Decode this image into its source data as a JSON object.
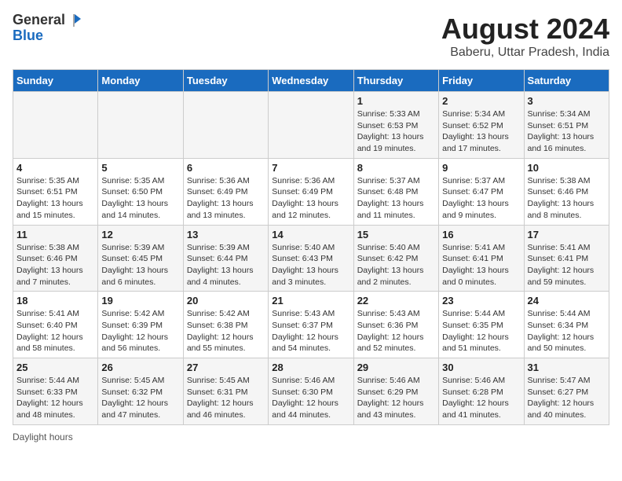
{
  "header": {
    "logo_line1": "General",
    "logo_line2": "Blue",
    "main_title": "August 2024",
    "subtitle": "Baberu, Uttar Pradesh, India"
  },
  "days_of_week": [
    "Sunday",
    "Monday",
    "Tuesday",
    "Wednesday",
    "Thursday",
    "Friday",
    "Saturday"
  ],
  "weeks": [
    [
      {
        "day": "",
        "info": ""
      },
      {
        "day": "",
        "info": ""
      },
      {
        "day": "",
        "info": ""
      },
      {
        "day": "",
        "info": ""
      },
      {
        "day": "1",
        "info": "Sunrise: 5:33 AM\nSunset: 6:53 PM\nDaylight: 13 hours and 19 minutes."
      },
      {
        "day": "2",
        "info": "Sunrise: 5:34 AM\nSunset: 6:52 PM\nDaylight: 13 hours and 17 minutes."
      },
      {
        "day": "3",
        "info": "Sunrise: 5:34 AM\nSunset: 6:51 PM\nDaylight: 13 hours and 16 minutes."
      }
    ],
    [
      {
        "day": "4",
        "info": "Sunrise: 5:35 AM\nSunset: 6:51 PM\nDaylight: 13 hours and 15 minutes."
      },
      {
        "day": "5",
        "info": "Sunrise: 5:35 AM\nSunset: 6:50 PM\nDaylight: 13 hours and 14 minutes."
      },
      {
        "day": "6",
        "info": "Sunrise: 5:36 AM\nSunset: 6:49 PM\nDaylight: 13 hours and 13 minutes."
      },
      {
        "day": "7",
        "info": "Sunrise: 5:36 AM\nSunset: 6:49 PM\nDaylight: 13 hours and 12 minutes."
      },
      {
        "day": "8",
        "info": "Sunrise: 5:37 AM\nSunset: 6:48 PM\nDaylight: 13 hours and 11 minutes."
      },
      {
        "day": "9",
        "info": "Sunrise: 5:37 AM\nSunset: 6:47 PM\nDaylight: 13 hours and 9 minutes."
      },
      {
        "day": "10",
        "info": "Sunrise: 5:38 AM\nSunset: 6:46 PM\nDaylight: 13 hours and 8 minutes."
      }
    ],
    [
      {
        "day": "11",
        "info": "Sunrise: 5:38 AM\nSunset: 6:46 PM\nDaylight: 13 hours and 7 minutes."
      },
      {
        "day": "12",
        "info": "Sunrise: 5:39 AM\nSunset: 6:45 PM\nDaylight: 13 hours and 6 minutes."
      },
      {
        "day": "13",
        "info": "Sunrise: 5:39 AM\nSunset: 6:44 PM\nDaylight: 13 hours and 4 minutes."
      },
      {
        "day": "14",
        "info": "Sunrise: 5:40 AM\nSunset: 6:43 PM\nDaylight: 13 hours and 3 minutes."
      },
      {
        "day": "15",
        "info": "Sunrise: 5:40 AM\nSunset: 6:42 PM\nDaylight: 13 hours and 2 minutes."
      },
      {
        "day": "16",
        "info": "Sunrise: 5:41 AM\nSunset: 6:41 PM\nDaylight: 13 hours and 0 minutes."
      },
      {
        "day": "17",
        "info": "Sunrise: 5:41 AM\nSunset: 6:41 PM\nDaylight: 12 hours and 59 minutes."
      }
    ],
    [
      {
        "day": "18",
        "info": "Sunrise: 5:41 AM\nSunset: 6:40 PM\nDaylight: 12 hours and 58 minutes."
      },
      {
        "day": "19",
        "info": "Sunrise: 5:42 AM\nSunset: 6:39 PM\nDaylight: 12 hours and 56 minutes."
      },
      {
        "day": "20",
        "info": "Sunrise: 5:42 AM\nSunset: 6:38 PM\nDaylight: 12 hours and 55 minutes."
      },
      {
        "day": "21",
        "info": "Sunrise: 5:43 AM\nSunset: 6:37 PM\nDaylight: 12 hours and 54 minutes."
      },
      {
        "day": "22",
        "info": "Sunrise: 5:43 AM\nSunset: 6:36 PM\nDaylight: 12 hours and 52 minutes."
      },
      {
        "day": "23",
        "info": "Sunrise: 5:44 AM\nSunset: 6:35 PM\nDaylight: 12 hours and 51 minutes."
      },
      {
        "day": "24",
        "info": "Sunrise: 5:44 AM\nSunset: 6:34 PM\nDaylight: 12 hours and 50 minutes."
      }
    ],
    [
      {
        "day": "25",
        "info": "Sunrise: 5:44 AM\nSunset: 6:33 PM\nDaylight: 12 hours and 48 minutes."
      },
      {
        "day": "26",
        "info": "Sunrise: 5:45 AM\nSunset: 6:32 PM\nDaylight: 12 hours and 47 minutes."
      },
      {
        "day": "27",
        "info": "Sunrise: 5:45 AM\nSunset: 6:31 PM\nDaylight: 12 hours and 46 minutes."
      },
      {
        "day": "28",
        "info": "Sunrise: 5:46 AM\nSunset: 6:30 PM\nDaylight: 12 hours and 44 minutes."
      },
      {
        "day": "29",
        "info": "Sunrise: 5:46 AM\nSunset: 6:29 PM\nDaylight: 12 hours and 43 minutes."
      },
      {
        "day": "30",
        "info": "Sunrise: 5:46 AM\nSunset: 6:28 PM\nDaylight: 12 hours and 41 minutes."
      },
      {
        "day": "31",
        "info": "Sunrise: 5:47 AM\nSunset: 6:27 PM\nDaylight: 12 hours and 40 minutes."
      }
    ]
  ],
  "footer": "Daylight hours"
}
